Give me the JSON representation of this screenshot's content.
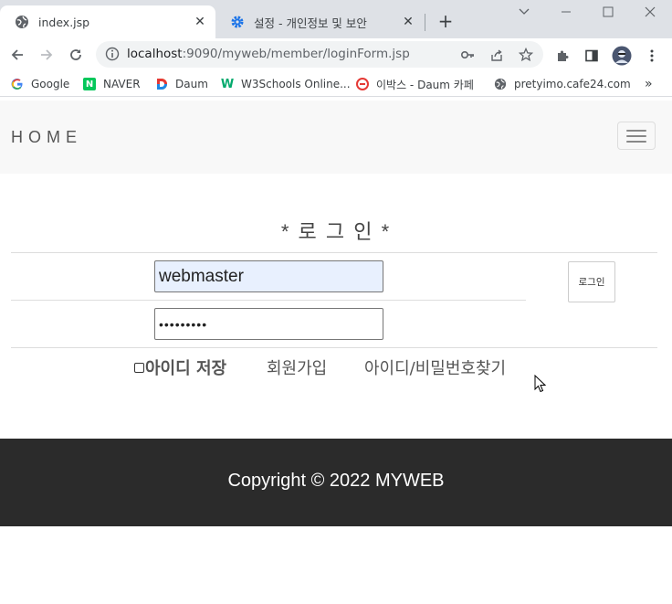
{
  "browser": {
    "tabs": [
      {
        "title": "index.jsp",
        "icon": "globe-icon",
        "active": true
      },
      {
        "title": "설정 - 개인정보 및 보안",
        "icon": "gear-icon",
        "active": false
      }
    ],
    "address": {
      "host": "localhost",
      "rest": ":9090/myweb/member/loginForm.jsp"
    },
    "bookmarks": [
      {
        "label": "Google",
        "icon": "google-icon"
      },
      {
        "label": "NAVER",
        "icon": "naver-icon"
      },
      {
        "label": "Daum",
        "icon": "daum-icon"
      },
      {
        "label": "W3Schools Online...",
        "icon": "w3schools-icon"
      },
      {
        "label": "이박스 - Daum 카페",
        "icon": "ebox-icon"
      },
      {
        "label": "pretyimo.cafe24.com",
        "icon": "globe-icon"
      }
    ],
    "more_bookmarks": "»"
  },
  "page": {
    "brand": "HOME",
    "login_title": "* 로 그 인 *",
    "id_value": "webmaster",
    "password_mask": "•••••••••",
    "login_button": "로그인",
    "remember_label": "아이디 저장",
    "signup_link": "회원가입",
    "find_link": "아이디/비밀번호찾기",
    "copyright": "Copyright © 2022 MYWEB"
  }
}
